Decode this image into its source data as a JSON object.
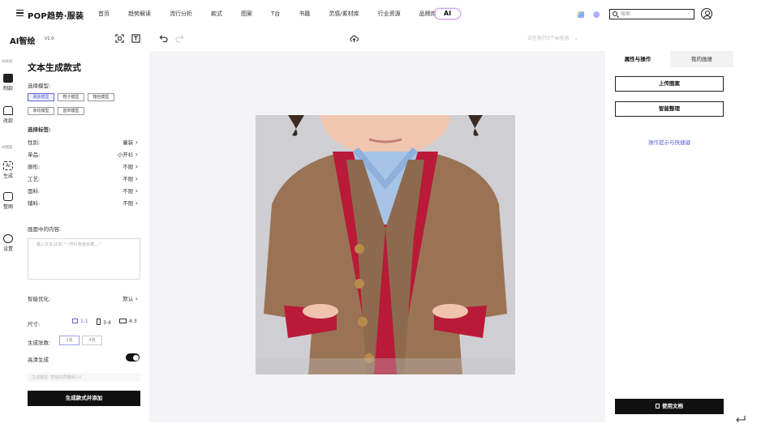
{
  "header": {
    "logo": "POP趋势·服装",
    "nav": [
      "首页",
      "趋势解读",
      "流行分析",
      "款式",
      "图案",
      "T台",
      "书籍",
      "灵感/素材库",
      "行业资源",
      "品牌库"
    ],
    "ai_badge": "AI",
    "search_placeholder": "搜索"
  },
  "toolbar": {
    "app_title": "AI智绘",
    "version": "V1.0",
    "task_status": "正在执行0个AI任务"
  },
  "rail": {
    "group1": "AI款式",
    "group2": "AI图案",
    "items": [
      "制款",
      "改款",
      "生成",
      "整图",
      "设置"
    ]
  },
  "left": {
    "title": "文本生成款式",
    "model_label": "选择模型:",
    "models": [
      "服装模型",
      "鞋子模型",
      "箱包模型",
      "家纺模型",
      "首饰模型"
    ],
    "tags_label": "选择标签:",
    "tags": [
      {
        "k": "性别:",
        "v": "童装"
      },
      {
        "k": "单品:",
        "v": "小开衫"
      },
      {
        "k": "廓形:",
        "v": "不限"
      },
      {
        "k": "工艺:",
        "v": "不限"
      },
      {
        "k": "面料:",
        "v": "不限"
      },
      {
        "k": "辅料:",
        "v": "不限"
      }
    ],
    "content_label": "画面中的内容:",
    "content_placeholder": "输入文本,比如:“一件红色连衣裙,…”",
    "smart_label": "智能优化:",
    "smart_value": "默认",
    "size_label": "尺寸:",
    "sizes": [
      "1:1",
      "3:4",
      "4:3"
    ],
    "count_label": "生成张数:",
    "counts": [
      "1张",
      "4张"
    ],
    "hd_label": "高清生成",
    "seed_placeholder": "生成模型: 智能高质量版1.0",
    "generate_button": "生成款式并添加"
  },
  "right": {
    "tab_active": "属性与操作",
    "tab_inactive": "我的画册",
    "upload_button": "上传图案",
    "smart_button": "智能整理",
    "hint_link": "操作提示与快捷键",
    "doc_button": "使用文档"
  },
  "colors": {
    "accent": "#5b66d6",
    "dark": "#111111"
  }
}
